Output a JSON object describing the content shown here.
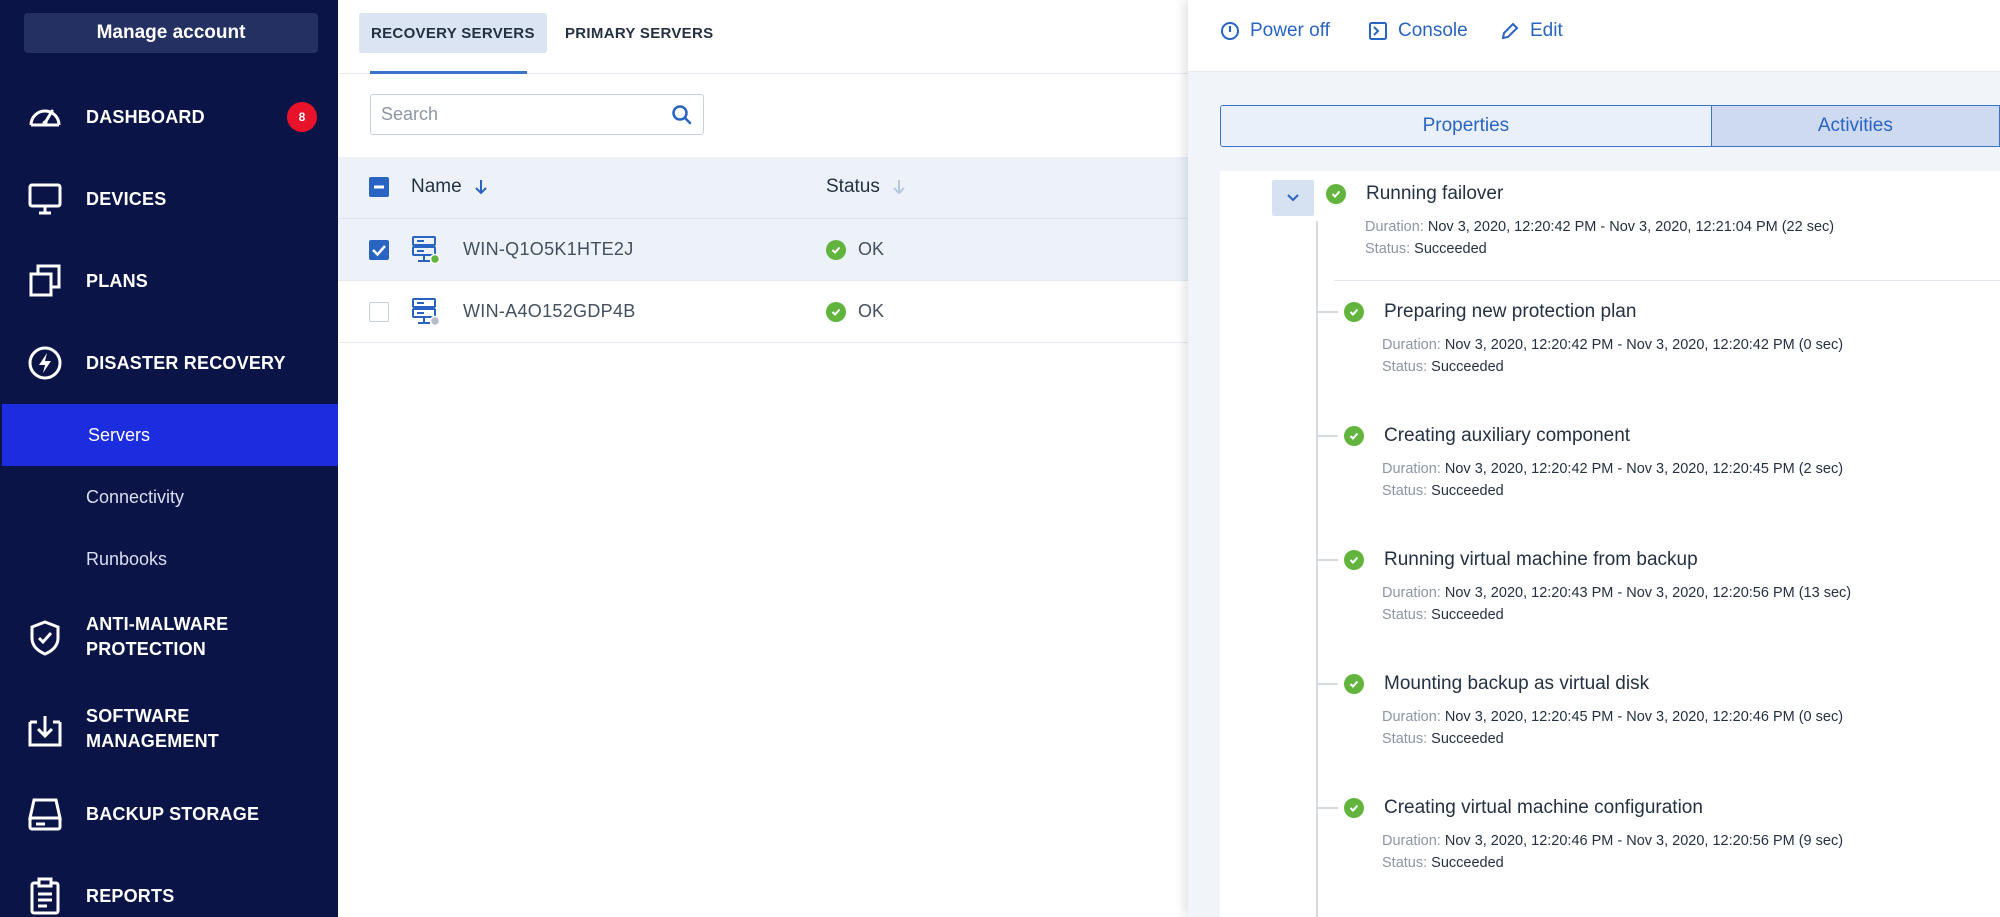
{
  "sidebar": {
    "manage_account": "Manage account",
    "items": [
      {
        "label": "DASHBOARD",
        "icon": "dashboard-gauge-icon",
        "badge": "8"
      },
      {
        "label": "DEVICES",
        "icon": "monitor-icon"
      },
      {
        "label": "PLANS",
        "icon": "plans-stack-icon"
      },
      {
        "label": "DISASTER RECOVERY",
        "icon": "lightning-icon"
      },
      {
        "label": "ANTI-MALWARE PROTECTION",
        "line1": "ANTI-MALWARE",
        "line2": "PROTECTION",
        "icon": "shield-check-icon"
      },
      {
        "label": "SOFTWARE MANAGEMENT",
        "line1": "SOFTWARE",
        "line2": "MANAGEMENT",
        "icon": "software-download-icon"
      },
      {
        "label": "BACKUP STORAGE",
        "icon": "storage-drive-icon"
      },
      {
        "label": "REPORTS",
        "icon": "report-clipboard-icon"
      }
    ],
    "sub_items": [
      "Servers",
      "Connectivity",
      "Runbooks"
    ],
    "active_sub_item": "Servers"
  },
  "list": {
    "tabs": [
      {
        "label": "RECOVERY SERVERS",
        "active": true
      },
      {
        "label": "PRIMARY SERVERS",
        "active": false
      }
    ],
    "search_placeholder": "Search",
    "columns": {
      "name": "Name",
      "status": "Status"
    },
    "rows": [
      {
        "name": "WIN-Q1O5K1HTE2J",
        "status": "OK",
        "selected": true
      },
      {
        "name": "WIN-A4O152GDP4B",
        "status": "OK",
        "selected": false
      }
    ]
  },
  "detail": {
    "toolbar": {
      "power_off": "Power off",
      "console": "Console",
      "edit": "Edit"
    },
    "tabs": {
      "properties": "Properties",
      "activities": "Activities",
      "active": "Activities"
    },
    "labels": {
      "duration": "Duration:",
      "status": "Status:"
    },
    "activity": {
      "title": "Running failover",
      "duration": "Nov 3, 2020, 12:20:42 PM - Nov 3, 2020, 12:21:04 PM (22 sec)",
      "status": "Succeeded",
      "steps": [
        {
          "title": "Preparing new protection plan",
          "duration": "Nov 3, 2020, 12:20:42 PM - Nov 3, 2020, 12:20:42 PM (0 sec)",
          "status": "Succeeded"
        },
        {
          "title": "Creating auxiliary component",
          "duration": "Nov 3, 2020, 12:20:42 PM - Nov 3, 2020, 12:20:45 PM (2 sec)",
          "status": "Succeeded"
        },
        {
          "title": "Running virtual machine from backup",
          "duration": "Nov 3, 2020, 12:20:43 PM - Nov 3, 2020, 12:20:56 PM (13 sec)",
          "status": "Succeeded"
        },
        {
          "title": "Mounting backup as virtual disk",
          "duration": "Nov 3, 2020, 12:20:45 PM - Nov 3, 2020, 12:20:46 PM (0 sec)",
          "status": "Succeeded"
        },
        {
          "title": "Creating virtual machine configuration",
          "duration": "Nov 3, 2020, 12:20:46 PM - Nov 3, 2020, 12:20:56 PM (9 sec)",
          "status": "Succeeded"
        }
      ]
    }
  },
  "colors": {
    "sidebar_bg": "#0b1446",
    "sidebar_active": "#1c2de0",
    "accent_blue": "#2a64c3",
    "ok_green": "#62b43e",
    "badge_red": "#e8132a"
  }
}
